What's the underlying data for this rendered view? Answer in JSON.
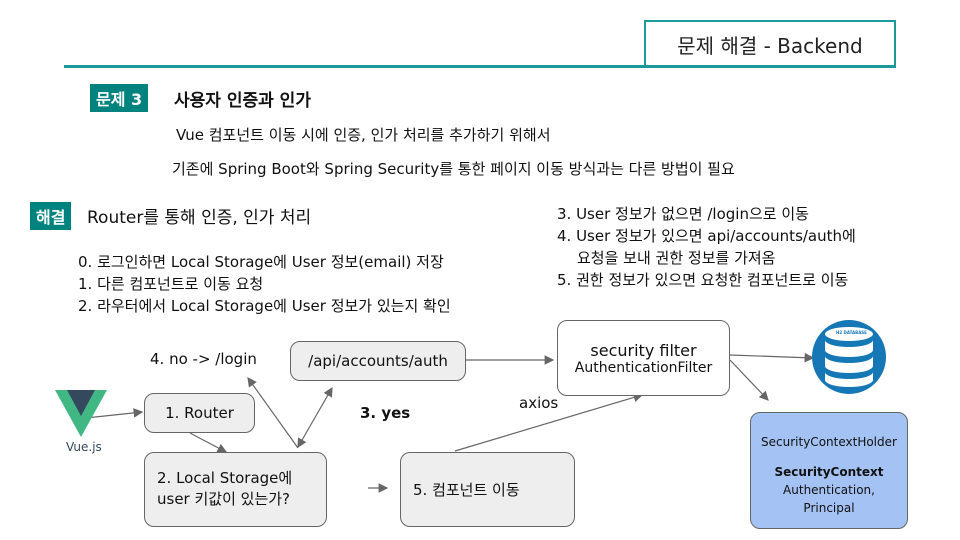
{
  "header": {
    "title": "문제 해결 - Backend"
  },
  "problem": {
    "tag": "문제 3",
    "title": "사용자 인증과 인가",
    "line1": "Vue 컴포넌트 이동 시에 인증, 인가 처리를 추가하기 위해서",
    "line2": "기존에 Spring Boot와 Spring Security를 통한 페이지 이동 방식과는 다른 방법이 필요"
  },
  "solution": {
    "tag": "해결",
    "title": "Router를 통해 인증, 인가 처리",
    "steps_left": [
      "0. 로그인하면 Local Storage에 User 정보(email) 저장",
      "1. 다른 컴포넌트로 이동 요청",
      "2. 라우터에서 Local Storage에 User 정보가 있는지 확인"
    ],
    "steps_right": [
      "3. User 정보가 없으면 /login으로 이동",
      "4. User 정보가 있으면 api/accounts/auth에",
      "요청을 보내 권한 정보를 가져옴",
      "5. 권한 정보가 있으면 요청한 컴포넌트로 이동"
    ]
  },
  "diagram": {
    "vue_label": "Vue.js",
    "router": "1. Router",
    "storage_line1": "2. Local Storage에",
    "storage_line2": "user 키값이 있는가?",
    "component": "5. 컴포넌트 이동",
    "api": "/api/accounts/auth",
    "no_label": "4. no -> /login",
    "yes_label": "3. yes",
    "axios": "axios",
    "filter_line1": "security filter",
    "filter_line2": "AuthenticationFilter",
    "db_label": "H2 DATABASE",
    "holder": "SecurityContextHolder",
    "context": "SecurityContext",
    "auth_line1": "Authentication,",
    "auth_line2": "Principal"
  },
  "colors": {
    "accent": "#00827f",
    "holder_fill": "#a4c2f4",
    "db": "#1577b5"
  }
}
